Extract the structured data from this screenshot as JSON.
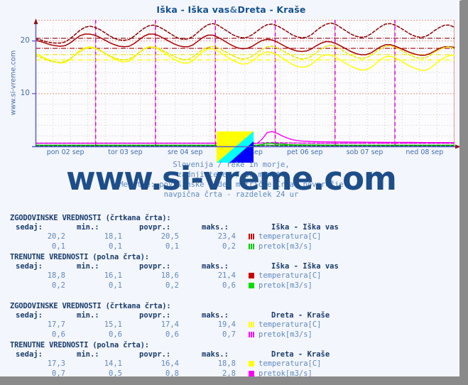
{
  "title": {
    "left": "Iška - Iška vas",
    "amp": "&",
    "right": "Dreta - Kraše"
  },
  "site_label": "www.si-vreme.com",
  "subtitle": {
    "line1": "Slovenija / reke in morje,",
    "line2": "zadnji teden / 30 minut.",
    "line3": "Meritve: površinske vode: metrične Črta: povprečje",
    "line4": "navpična črta - razdelek 24 ur"
  },
  "watermark": "www.si-vreme.com",
  "chart_data": {
    "type": "line",
    "title": "Iška - Iška vas & Dreta - Kraše",
    "xlabel": "",
    "ylabel": "",
    "ylim": [
      0,
      24
    ],
    "yticks": [
      10,
      20
    ],
    "grid": true,
    "legend_position": "below-table",
    "xticks": [
      "pon 02 sep",
      "tor 03 sep",
      "sre 04 sep",
      "čet 05 sep",
      "pet 06 sep",
      "sob 07 sep",
      "ned 08 sep"
    ],
    "day_separators_every_hours": 24,
    "series": [
      {
        "name": "Iška - Iška vas temperatura[C] (trenutne)",
        "color": "#aa0000",
        "style": "solid",
        "unit": "C",
        "values": [
          20.1,
          19.9,
          19.6,
          19.3,
          19.1,
          19.0,
          19.1,
          19.6,
          20.3,
          21.0,
          21.3,
          21.3,
          21.1,
          20.7,
          20.2,
          19.7,
          19.3,
          19.0,
          18.9,
          19.0,
          19.5,
          20.2,
          20.9,
          21.3,
          21.3,
          21.0,
          20.5,
          20.0,
          19.5,
          19.1,
          18.9,
          18.9,
          19.3,
          20.0,
          20.7,
          21.1,
          21.1,
          20.7,
          20.2,
          19.6,
          19.1,
          18.7,
          18.5,
          18.6,
          19.0,
          19.6,
          20.1,
          20.3,
          20.2,
          19.8,
          19.3,
          18.8,
          18.4,
          18.1,
          18.0,
          18.1,
          18.5,
          19.1,
          19.6,
          19.9,
          19.8,
          19.5,
          19.0,
          18.5,
          18.0,
          17.6,
          17.4,
          17.4,
          17.7,
          18.3,
          18.9,
          19.3,
          19.3,
          19.0,
          18.6,
          18.2,
          17.8,
          17.5,
          17.3,
          17.3,
          17.6,
          18.1,
          18.6,
          18.9,
          18.9,
          18.8
        ]
      },
      {
        "name": "Iška - Iška vas temperatura[C] (zgodovinske)",
        "color": "#8b0000",
        "style": "dashed",
        "unit": "C",
        "values": [
          20.4,
          20.2,
          19.9,
          19.7,
          19.6,
          19.6,
          19.8,
          20.4,
          21.2,
          22.0,
          22.6,
          22.8,
          22.6,
          22.2,
          21.6,
          21.0,
          20.5,
          20.2,
          20.1,
          20.3,
          20.9,
          21.7,
          22.4,
          22.9,
          23.0,
          22.7,
          22.2,
          21.6,
          21.0,
          20.5,
          20.3,
          20.4,
          20.9,
          21.7,
          22.5,
          23.1,
          23.3,
          23.0,
          22.4,
          21.8,
          21.2,
          20.8,
          20.6,
          20.7,
          21.2,
          21.9,
          22.6,
          23.1,
          23.2,
          22.9,
          22.4,
          21.8,
          21.2,
          20.8,
          20.6,
          20.7,
          21.2,
          22.0,
          22.7,
          23.2,
          23.4,
          23.1,
          22.5,
          21.9,
          21.3,
          20.9,
          20.7,
          20.8,
          21.3,
          22.0,
          22.7,
          23.2,
          23.3,
          23.0,
          22.5,
          21.9,
          21.3,
          20.9,
          20.7,
          20.8,
          21.3,
          22.0,
          22.6,
          23.0,
          23.0,
          22.6
        ]
      },
      {
        "name": "Dreta - Kraše temperatura[C] (trenutne)",
        "color": "#ffff00",
        "style": "solid",
        "unit": "C",
        "values": [
          17.6,
          17.2,
          16.7,
          16.3,
          16.0,
          15.8,
          15.9,
          16.5,
          17.4,
          18.2,
          18.7,
          18.9,
          18.7,
          18.3,
          17.7,
          17.1,
          16.6,
          16.2,
          16.0,
          16.2,
          16.9,
          17.8,
          18.5,
          18.9,
          18.8,
          18.4,
          17.8,
          17.2,
          16.6,
          16.1,
          15.8,
          15.8,
          16.3,
          17.2,
          18.0,
          18.5,
          18.5,
          18.1,
          17.5,
          16.9,
          16.3,
          15.9,
          15.6,
          15.7,
          16.2,
          17.0,
          17.6,
          17.9,
          17.8,
          17.4,
          16.8,
          16.2,
          15.6,
          15.2,
          15.0,
          15.1,
          15.6,
          16.4,
          17.1,
          17.4,
          17.3,
          16.9,
          16.3,
          15.7,
          15.2,
          14.8,
          14.5,
          14.5,
          14.9,
          15.7,
          16.5,
          17.0,
          17.1,
          16.8,
          16.3,
          15.7,
          15.2,
          14.8,
          14.5,
          14.4,
          14.8,
          15.5,
          16.3,
          16.9,
          17.2,
          17.3
        ]
      },
      {
        "name": "Dreta - Kraše temperatura[C] (zgodovinske)",
        "color": "#e8e800",
        "style": "dashed",
        "unit": "C",
        "values": [
          17.2,
          16.9,
          16.5,
          16.2,
          16.0,
          15.9,
          16.1,
          16.6,
          17.3,
          18.0,
          18.5,
          18.7,
          18.6,
          18.2,
          17.7,
          17.2,
          16.8,
          16.5,
          16.4,
          16.6,
          17.1,
          17.8,
          18.4,
          18.8,
          18.9,
          18.6,
          18.1,
          17.6,
          17.1,
          16.7,
          16.5,
          16.5,
          17.0,
          17.7,
          18.4,
          18.8,
          19.0,
          18.7,
          18.2,
          17.7,
          17.2,
          16.8,
          16.6,
          16.7,
          17.1,
          17.8,
          18.4,
          18.9,
          19.0,
          18.7,
          18.2,
          17.7,
          17.2,
          16.8,
          16.6,
          16.7,
          17.1,
          17.8,
          18.5,
          19.0,
          19.2,
          18.9,
          18.4,
          17.8,
          17.3,
          16.9,
          16.7,
          16.8,
          17.2,
          17.9,
          18.5,
          19.0,
          19.1,
          18.8,
          18.3,
          17.8,
          17.3,
          16.9,
          16.7,
          16.8,
          17.2,
          17.9,
          18.4,
          18.8,
          18.9,
          18.5
        ]
      },
      {
        "name": "Dreta - Kraše pretok[m3/s] (trenutne)",
        "color": "#ff00ff",
        "style": "solid",
        "unit": "m3/s",
        "values": [
          0.6,
          0.6,
          0.6,
          0.6,
          0.6,
          0.6,
          0.6,
          0.6,
          0.6,
          0.6,
          0.6,
          0.6,
          0.6,
          0.6,
          0.6,
          0.6,
          0.6,
          0.6,
          0.6,
          0.6,
          0.6,
          0.6,
          0.6,
          0.6,
          0.6,
          0.6,
          0.6,
          0.6,
          0.6,
          0.6,
          0.6,
          0.6,
          0.6,
          0.6,
          0.6,
          0.6,
          0.6,
          0.6,
          0.6,
          0.6,
          0.6,
          0.5,
          0.5,
          0.5,
          0.5,
          0.6,
          1.4,
          2.6,
          2.8,
          2.5,
          2.0,
          1.6,
          1.3,
          1.1,
          1.0,
          0.95,
          0.9,
          0.88,
          0.86,
          0.85,
          0.84,
          0.83,
          0.82,
          0.81,
          0.8,
          0.8,
          0.79,
          0.78,
          0.78,
          0.77,
          0.77,
          0.76,
          0.76,
          0.75,
          0.75,
          0.74,
          0.74,
          0.73,
          0.73,
          0.72,
          0.72,
          0.72,
          0.71,
          0.71,
          0.7,
          0.7
        ]
      },
      {
        "name": "Dreta - Kraše pretok[m3/s] (zgodovinske)",
        "color": "#d000d0",
        "style": "dashed",
        "unit": "m3/s",
        "values": [
          0.6,
          0.6,
          0.6,
          0.6,
          0.6,
          0.6,
          0.6,
          0.6,
          0.6,
          0.6,
          0.6,
          0.6,
          0.6,
          0.6,
          0.6,
          0.6,
          0.6,
          0.6,
          0.6,
          0.6,
          0.6,
          0.6,
          0.6,
          0.6,
          0.6,
          0.6,
          0.6,
          0.6,
          0.6,
          0.6,
          0.6,
          0.6,
          0.6,
          0.6,
          0.6,
          0.6,
          0.6,
          0.6,
          0.6,
          0.6,
          0.6,
          0.6,
          0.6,
          0.6,
          0.6,
          0.6,
          0.65,
          0.7,
          0.7,
          0.68,
          0.66,
          0.65,
          0.64,
          0.63,
          0.62,
          0.62,
          0.61,
          0.61,
          0.61,
          0.6,
          0.6,
          0.6,
          0.6,
          0.6,
          0.6,
          0.6,
          0.6,
          0.6,
          0.6,
          0.6,
          0.6,
          0.6,
          0.6,
          0.6,
          0.6,
          0.6,
          0.6,
          0.6,
          0.6,
          0.6,
          0.6,
          0.6,
          0.6,
          0.6,
          0.6,
          0.6
        ]
      },
      {
        "name": "Iška - Iška vas pretok[m3/s] (trenutne)",
        "color": "#00c000",
        "style": "solid",
        "unit": "m3/s",
        "values": [
          0.2,
          0.2,
          0.2,
          0.2,
          0.2,
          0.2,
          0.2,
          0.2,
          0.2,
          0.2,
          0.2,
          0.2,
          0.2,
          0.2,
          0.2,
          0.2,
          0.2,
          0.2,
          0.2,
          0.2,
          0.2,
          0.2,
          0.2,
          0.2,
          0.2,
          0.2,
          0.2,
          0.2,
          0.2,
          0.2,
          0.2,
          0.2,
          0.2,
          0.2,
          0.2,
          0.2,
          0.2,
          0.2,
          0.2,
          0.2,
          0.2,
          0.2,
          0.2,
          0.2,
          0.2,
          0.2,
          0.35,
          0.6,
          0.55,
          0.45,
          0.4,
          0.35,
          0.3,
          0.28,
          0.27,
          0.26,
          0.25,
          0.25,
          0.24,
          0.24,
          0.23,
          0.23,
          0.22,
          0.22,
          0.22,
          0.21,
          0.21,
          0.21,
          0.21,
          0.2,
          0.2,
          0.2,
          0.2,
          0.2,
          0.2,
          0.2,
          0.2,
          0.2,
          0.2,
          0.2,
          0.2,
          0.2,
          0.2,
          0.2,
          0.2,
          0.2
        ]
      },
      {
        "name": "Iška - Iška vas pretok[m3/s] (zgodovinske)",
        "color": "#007000",
        "style": "dashed",
        "unit": "m3/s",
        "values": [
          0.1,
          0.1,
          0.1,
          0.1,
          0.1,
          0.1,
          0.1,
          0.1,
          0.1,
          0.1,
          0.1,
          0.1,
          0.1,
          0.1,
          0.1,
          0.1,
          0.1,
          0.1,
          0.1,
          0.1,
          0.1,
          0.1,
          0.1,
          0.1,
          0.1,
          0.1,
          0.1,
          0.1,
          0.1,
          0.1,
          0.1,
          0.1,
          0.1,
          0.1,
          0.1,
          0.1,
          0.1,
          0.1,
          0.1,
          0.1,
          0.1,
          0.1,
          0.1,
          0.1,
          0.1,
          0.1,
          0.15,
          0.2,
          0.18,
          0.15,
          0.13,
          0.12,
          0.12,
          0.11,
          0.11,
          0.11,
          0.1,
          0.1,
          0.1,
          0.1,
          0.1,
          0.1,
          0.1,
          0.1,
          0.1,
          0.1,
          0.1,
          0.1,
          0.1,
          0.1,
          0.1,
          0.1,
          0.1,
          0.1,
          0.1,
          0.1,
          0.1,
          0.1,
          0.1,
          0.1,
          0.1,
          0.1,
          0.1,
          0.1,
          0.1,
          0.1
        ]
      }
    ],
    "reference_lines": [
      {
        "value": 20.5,
        "color": "#8b0000",
        "style": "dashdot",
        "label": "Iška povpr. zgodovinske temperatura"
      },
      {
        "value": 18.6,
        "color": "#aa0000",
        "style": "dashdot",
        "label": "Iška povpr. trenutne temperatura"
      },
      {
        "value": 17.4,
        "color": "#e8e800",
        "style": "dashdot",
        "label": "Dreta povpr. zgodovinske temperatura"
      },
      {
        "value": 16.4,
        "color": "#ffff00",
        "style": "dashdot",
        "label": "Dreta povpr. trenutne temperatura"
      },
      {
        "value": 0.6,
        "color": "#ff00ff",
        "style": "dashdot",
        "label": "Dreta povpr. pretok"
      },
      {
        "value": 0.2,
        "color": "#00c000",
        "style": "dashdot",
        "label": "Iška povpr. pretok"
      }
    ]
  },
  "tables": [
    {
      "section_title": "ZGODOVINSKE VREDNOSTI (črtkana črta):",
      "headers": {
        "now": "sedaj:",
        "min": "min.:",
        "avg": "povpr.:",
        "max": "maks.:",
        "station": "Iška - Iška vas"
      },
      "rows": [
        {
          "now": "20,2",
          "min": "18,1",
          "avg": "20,5",
          "max": "23,4",
          "color": "#cc0000",
          "dashed": true,
          "label": "temperatura[C]"
        },
        {
          "now": "0,1",
          "min": "0,1",
          "avg": "0,1",
          "max": "0,2",
          "color": "#00cc00",
          "dashed": true,
          "label": "pretok[m3/s]"
        }
      ]
    },
    {
      "section_title": "TRENUTNE VREDNOSTI (polna črta):",
      "headers": {
        "now": "sedaj:",
        "min": "min.:",
        "avg": "povpr.:",
        "max": "maks.:",
        "station": "Iška - Iška vas"
      },
      "rows": [
        {
          "now": "18,8",
          "min": "16,1",
          "avg": "18,6",
          "max": "21,4",
          "color": "#cc0000",
          "dashed": false,
          "label": "temperatura[C]"
        },
        {
          "now": "0,2",
          "min": "0,1",
          "avg": "0,2",
          "max": "0,6",
          "color": "#00dd00",
          "dashed": false,
          "label": "pretok[m3/s]"
        }
      ]
    },
    {
      "section_title": "ZGODOVINSKE VREDNOSTI (črtkana črta):",
      "headers": {
        "now": "sedaj:",
        "min": "min.:",
        "avg": "povpr.:",
        "max": "maks.:",
        "station": "Dreta - Kraše"
      },
      "rows": [
        {
          "now": "17,7",
          "min": "15,1",
          "avg": "17,4",
          "max": "19,4",
          "color": "#ffff00",
          "dashed": true,
          "label": "temperatura[C]"
        },
        {
          "now": "0,6",
          "min": "0,6",
          "avg": "0,6",
          "max": "0,7",
          "color": "#ff00ff",
          "dashed": true,
          "label": "pretok[m3/s]"
        }
      ]
    },
    {
      "section_title": "TRENUTNE VREDNOSTI (polna črta):",
      "headers": {
        "now": "sedaj:",
        "min": "min.:",
        "avg": "povpr.:",
        "max": "maks.:",
        "station": "Dreta - Kraše"
      },
      "rows": [
        {
          "now": "17,3",
          "min": "14,1",
          "avg": "16,4",
          "max": "18,8",
          "color": "#ffff00",
          "dashed": false,
          "label": "temperatura[C]"
        },
        {
          "now": "0,7",
          "min": "0,5",
          "avg": "0,8",
          "max": "2,8",
          "color": "#ff00ff",
          "dashed": false,
          "label": "pretok[m3/s]"
        }
      ]
    }
  ]
}
